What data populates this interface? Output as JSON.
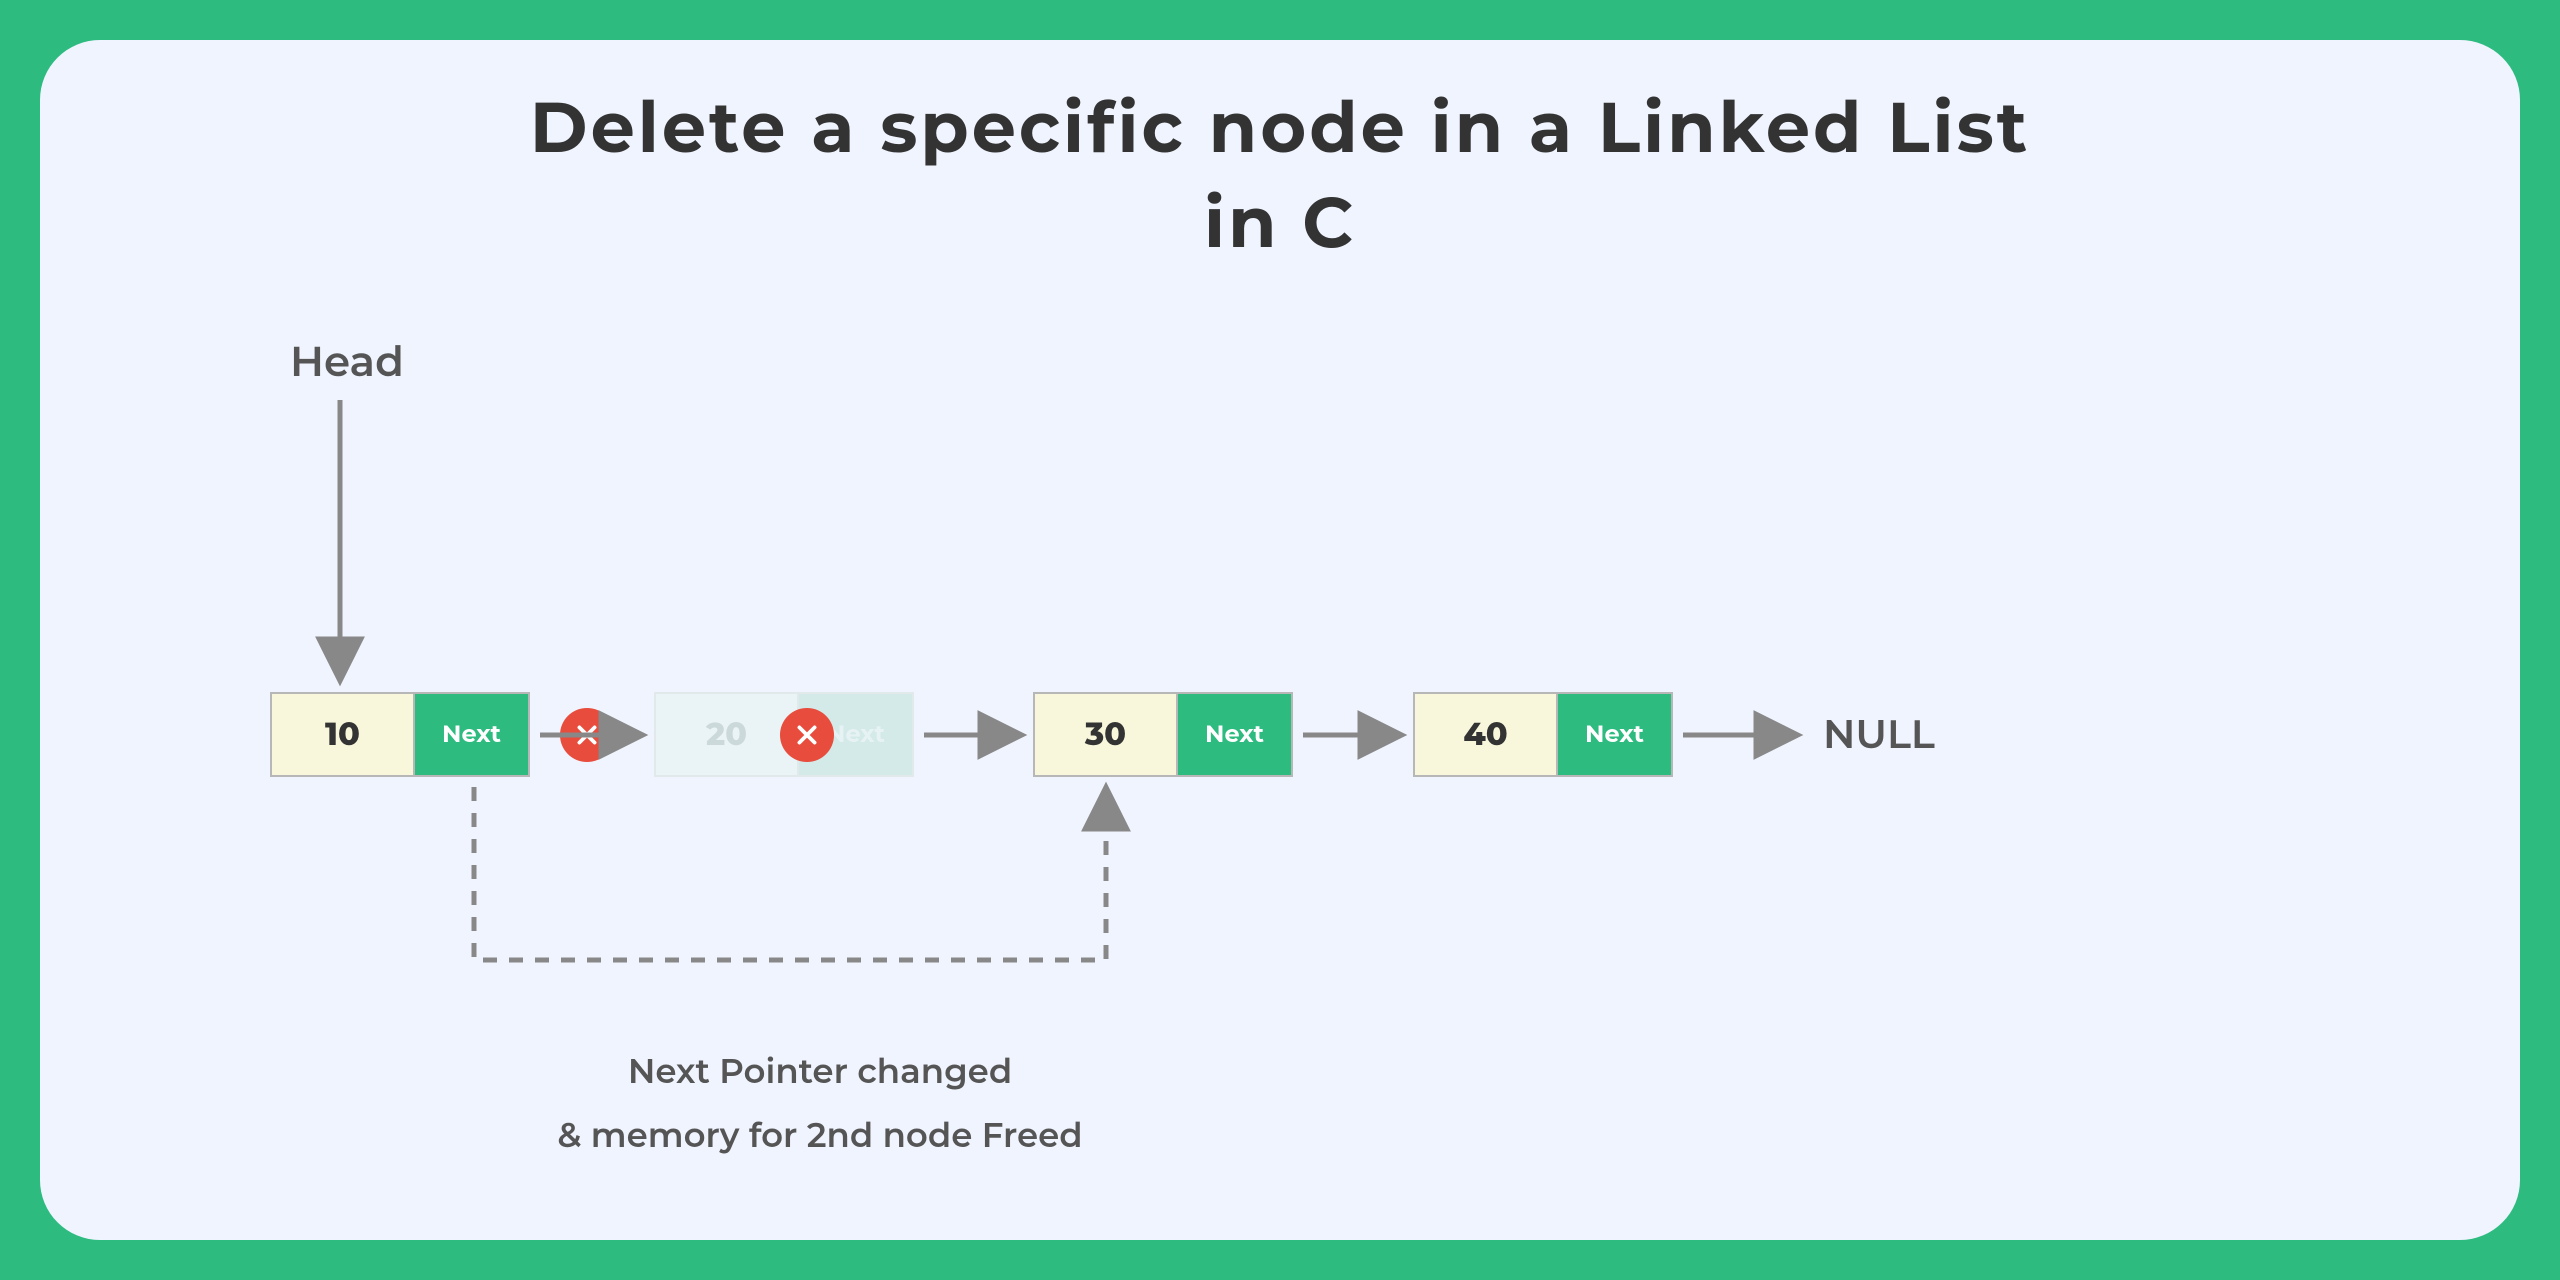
{
  "title_line1": "Delete a specific node in a Linked List",
  "title_line2": "in C",
  "head_label": "Head",
  "null_label": "NULL",
  "next_label": "Next",
  "nodes": [
    {
      "value": "10",
      "deleted": false
    },
    {
      "value": "20",
      "deleted": true
    },
    {
      "value": "30",
      "deleted": false
    },
    {
      "value": "40",
      "deleted": false
    }
  ],
  "caption_line1": "Next Pointer changed",
  "caption_line2": "& memory for 2nd node Freed",
  "colors": {
    "accent": "#2dbb80",
    "node_bg": "#f9f7db",
    "canvas_bg": "#f0f4fe",
    "delete_icon": "#e74c3c",
    "text": "#333333",
    "muted": "#555555",
    "arrow": "#888888"
  }
}
